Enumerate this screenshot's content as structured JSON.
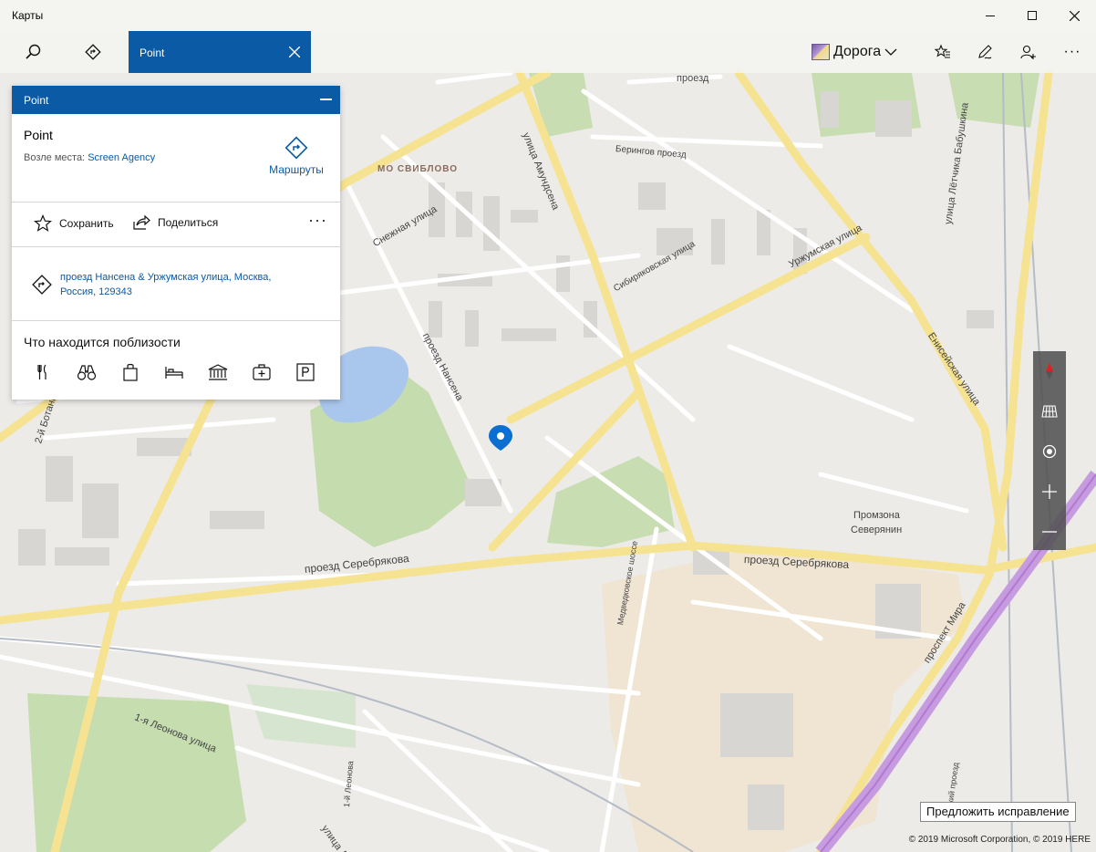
{
  "window": {
    "title": "Карты"
  },
  "toolbar": {
    "search_tab_label": "Point",
    "map_style_label": "Дорога"
  },
  "card": {
    "header_title": "Point",
    "place_name": "Point",
    "near_prefix": "Возле места:",
    "near_link": "Screen Agency",
    "routes_label": "Маршруты",
    "save_label": "Сохранить",
    "share_label": "Поделиться",
    "address_line1": "проезд Нансена & Уржумская улица, Москва,",
    "address_line2": "Россия, 129343",
    "nearby_title": "Что находится поблизости"
  },
  "map": {
    "labels": {
      "serebryakova_1": "проезд Серебрякова",
      "serebryakova_2": "проезд Серебрякова",
      "nansena": "проезд Нансена",
      "urzhumskaya": "Уржумская улица",
      "snezhnaya": "Снежная улица",
      "amundsena": "улица Амундсена",
      "sviblovo": "МО СВИБЛОВО",
      "beringov": "Берингов проезд",
      "sibiryakovskaya": "Сибиряковская улица",
      "eniseyskaya": "Енисейская улица",
      "babushkina": "улица Лётчика Бабушкина",
      "prospekt_mira": "проспект Мира",
      "promzona_1": "Промзона",
      "promzona_2": "Северянин",
      "medvedkovskoe": "Медведковское шоссе",
      "leonova": "1-я Леонова улица",
      "botanicheskaya": "2-й Ботани",
      "proezd_top": "проезд",
      "leonova_1": "1-й Леонова",
      "ulitsa_ded": "улица Де",
      "yanskiy": "янский проезд"
    }
  },
  "footer": {
    "suggest_label": "Предложить исправление",
    "copyright": "© 2019 Microsoft Corporation, © 2019 HERE"
  }
}
